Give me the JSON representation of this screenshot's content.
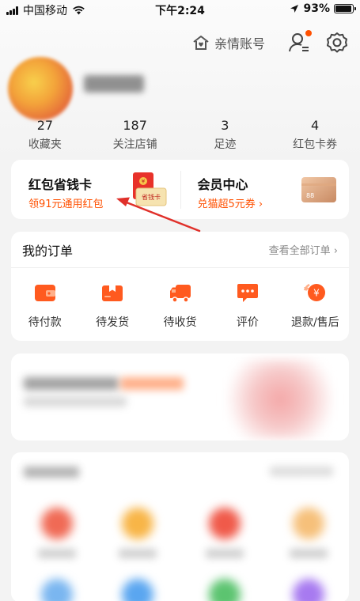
{
  "status_bar": {
    "carrier": "中国移动",
    "time": "下午2:24",
    "battery": "93%",
    "battery_level": 0.93
  },
  "header": {
    "family_account_label": "亲情账号"
  },
  "stats": [
    {
      "count": "27",
      "label": "收藏夹"
    },
    {
      "count": "187",
      "label": "关注店铺"
    },
    {
      "count": "3",
      "label": "足迹"
    },
    {
      "count": "4",
      "label": "红包卡券"
    }
  ],
  "promo": {
    "left": {
      "title": "红包省钱卡",
      "subtitle": "领91元通用红包",
      "card_text": "省钱卡"
    },
    "right": {
      "title": "会员中心",
      "subtitle": "兑猫超5元券 ›",
      "card_text": "88"
    }
  },
  "orders": {
    "title": "我的订单",
    "view_all": "查看全部订单 ›",
    "items": [
      {
        "label": "待付款",
        "icon": "wallet-icon"
      },
      {
        "label": "待发货",
        "icon": "gift-box-icon"
      },
      {
        "label": "待收货",
        "icon": "truck-icon"
      },
      {
        "label": "评价",
        "icon": "comment-icon"
      },
      {
        "label": "退款/售后",
        "icon": "refund-icon"
      }
    ]
  },
  "colors": {
    "accent": "#ff5000",
    "annotation_arrow": "#e0302a"
  }
}
